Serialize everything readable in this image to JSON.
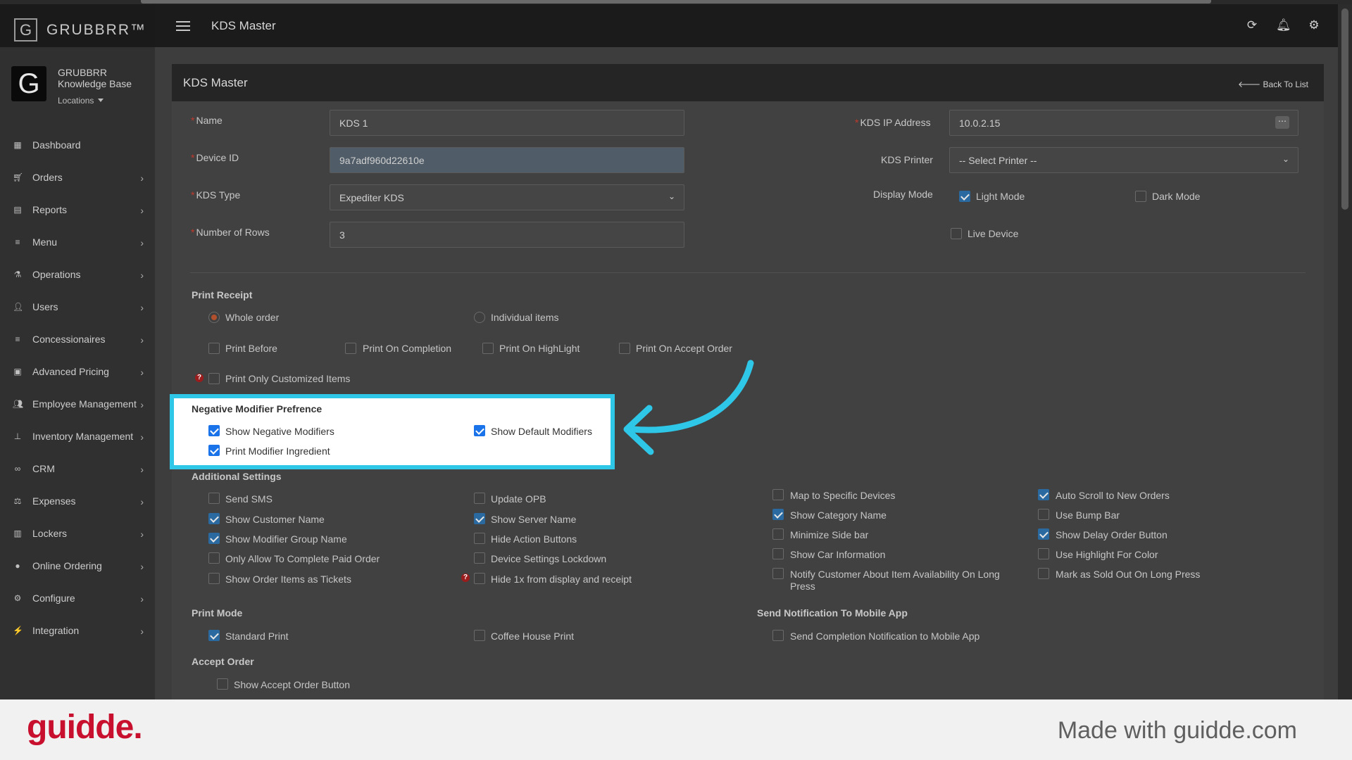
{
  "brand": {
    "name": "GRUBBRR™",
    "logo_letter": "G"
  },
  "account": {
    "logo_letter": "G",
    "name_line1": "GRUBBRR",
    "name_line2": "Knowledge Base",
    "locations_label": "Locations"
  },
  "sidebar": {
    "items": [
      {
        "label": "Dashboard",
        "icon": "dashboard-icon",
        "has_submenu": false
      },
      {
        "label": "Orders",
        "icon": "cart-icon",
        "has_submenu": true
      },
      {
        "label": "Reports",
        "icon": "report-icon",
        "has_submenu": true
      },
      {
        "label": "Menu",
        "icon": "list-icon",
        "has_submenu": true
      },
      {
        "label": "Operations",
        "icon": "flask-icon",
        "has_submenu": true
      },
      {
        "label": "Users",
        "icon": "user-plus-icon",
        "has_submenu": true
      },
      {
        "label": "Concessionaires",
        "icon": "list-icon",
        "has_submenu": true
      },
      {
        "label": "Advanced Pricing",
        "icon": "money-icon",
        "has_submenu": true
      },
      {
        "label": "Employee Management",
        "icon": "users-icon",
        "has_submenu": true
      },
      {
        "label": "Inventory Management",
        "icon": "sitemap-icon",
        "has_submenu": true
      },
      {
        "label": "CRM",
        "icon": "link-icon",
        "has_submenu": true
      },
      {
        "label": "Expenses",
        "icon": "balance-icon",
        "has_submenu": true
      },
      {
        "label": "Lockers",
        "icon": "lock-icon",
        "has_submenu": true
      },
      {
        "label": "Online Ordering",
        "icon": "globe-icon",
        "has_submenu": true
      },
      {
        "label": "Configure",
        "icon": "gear-icon",
        "has_submenu": true
      },
      {
        "label": "Integration",
        "icon": "plug-icon",
        "has_submenu": true
      }
    ]
  },
  "topbar": {
    "title": "KDS Master"
  },
  "panel": {
    "title": "KDS Master",
    "back_label": "Back To List"
  },
  "form": {
    "name": {
      "label": "Name",
      "value": "KDS 1"
    },
    "device_id": {
      "label": "Device ID",
      "value": "9a7adf960d22610e"
    },
    "kds_type": {
      "label": "KDS Type",
      "value": "Expediter KDS"
    },
    "rows": {
      "label": "Number of Rows",
      "value": "3"
    },
    "ip": {
      "label": "KDS IP Address",
      "value": "10.0.2.15"
    },
    "printer": {
      "label": "KDS Printer",
      "value": "-- Select Printer --"
    },
    "display_mode": {
      "label": "Display Mode",
      "light": "Light Mode",
      "light_checked": true,
      "dark": "Dark Mode",
      "dark_checked": false
    },
    "live_device": {
      "label": "Live Device",
      "checked": false
    }
  },
  "print_receipt": {
    "title": "Print Receipt",
    "whole_order": "Whole order",
    "individual_items": "Individual items",
    "selected": "whole_order",
    "print_before": "Print Before",
    "print_on_completion": "Print On Completion",
    "print_on_highlight": "Print On HighLight",
    "print_on_accept": "Print On Accept Order",
    "print_only_customized": "Print Only Customized Items"
  },
  "negative_modifier": {
    "title": "Negative Modifier Prefrence",
    "show_negative": {
      "label": "Show Negative Modifiers",
      "checked": true
    },
    "show_default": {
      "label": "Show Default Modifiers",
      "checked": true
    },
    "print_ingredient": {
      "label": "Print Modifier Ingredient",
      "checked": true
    }
  },
  "additional": {
    "title": "Additional Settings",
    "items": [
      {
        "label": "Send SMS",
        "checked": false
      },
      {
        "label": "Show Customer Name",
        "checked": true
      },
      {
        "label": "Show Modifier Group Name",
        "checked": true
      },
      {
        "label": "Only Allow To Complete Paid Order",
        "checked": false
      },
      {
        "label": "Show Order Items as Tickets",
        "checked": false
      },
      {
        "label": "Update OPB",
        "checked": false
      },
      {
        "label": "Show Server Name",
        "checked": true
      },
      {
        "label": "Hide Action Buttons",
        "checked": false
      },
      {
        "label": "Device Settings Lockdown",
        "checked": false
      },
      {
        "label": "Hide 1x from display and receipt",
        "checked": false
      },
      {
        "label": "Map to Specific Devices",
        "checked": false
      },
      {
        "label": "Show Category Name",
        "checked": true
      },
      {
        "label": "Minimize Side bar",
        "checked": false
      },
      {
        "label": "Show Car Information",
        "checked": false
      },
      {
        "label": "Notify Customer About Item Availability On Long Press",
        "checked": false
      },
      {
        "label": "Auto Scroll to New Orders",
        "checked": true
      },
      {
        "label": "Use Bump Bar",
        "checked": false
      },
      {
        "label": "Show Delay Order Button",
        "checked": true
      },
      {
        "label": "Use Highlight For Color",
        "checked": false
      },
      {
        "label": "Mark as Sold Out On Long Press",
        "checked": false
      }
    ]
  },
  "print_mode": {
    "title": "Print Mode",
    "standard": {
      "label": "Standard Print",
      "checked": true
    },
    "coffee": {
      "label": "Coffee House Print",
      "checked": false
    }
  },
  "notification": {
    "title": "Send Notification To Mobile App",
    "completion": {
      "label": "Send Completion Notification to Mobile App",
      "checked": false
    }
  },
  "accept_order": {
    "title": "Accept Order",
    "show_button": {
      "label": "Show Accept Order Button",
      "checked": false
    }
  },
  "footer": {
    "logo": "guidde.",
    "made_with": "Made with guidde.com"
  },
  "colors": {
    "highlight": "#2ec7e8",
    "guidde_red": "#c8102e",
    "checkbox_on": "#2a6aa0"
  }
}
